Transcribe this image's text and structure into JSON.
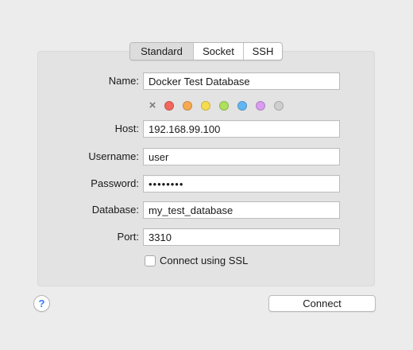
{
  "tabs": [
    {
      "label": "Standard",
      "active": true
    },
    {
      "label": "Socket",
      "active": false
    },
    {
      "label": "SSH",
      "active": false
    }
  ],
  "form": {
    "name": {
      "label": "Name:",
      "value": "Docker Test Database"
    },
    "host": {
      "label": "Host:",
      "value": "192.168.99.100"
    },
    "username": {
      "label": "Username:",
      "value": "user"
    },
    "password": {
      "label": "Password:",
      "value": "••••••••"
    },
    "database": {
      "label": "Database:",
      "value": "my_test_database"
    },
    "port": {
      "label": "Port:",
      "value": "3310"
    },
    "ssl": {
      "label": "Connect using SSL",
      "checked": false
    }
  },
  "color_tags": {
    "clear_icon": "×",
    "colors": [
      "#f1675d",
      "#f6a951",
      "#f6dc4f",
      "#aee05d",
      "#62b6f2",
      "#d99cf0",
      "#cfcfcf"
    ]
  },
  "footer": {
    "help_label": "?",
    "connect_label": "Connect"
  }
}
